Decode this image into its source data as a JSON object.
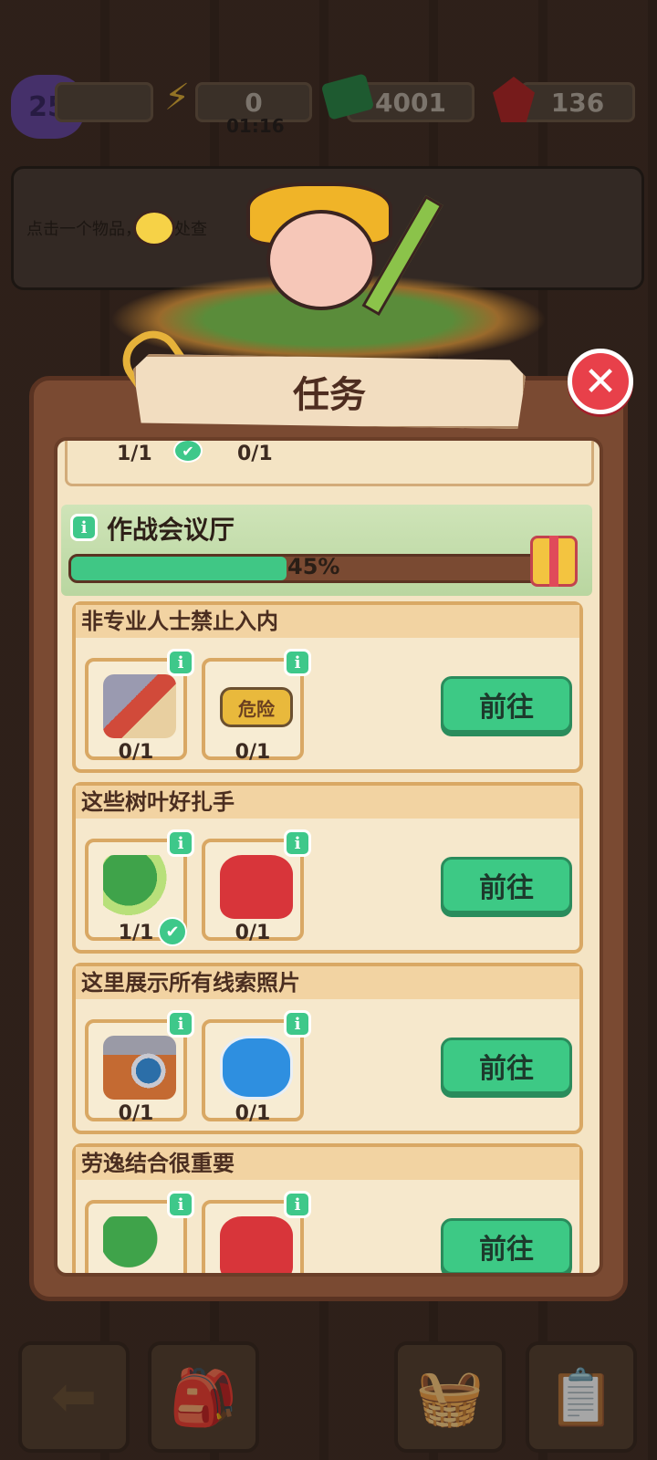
{
  "top": {
    "level": "25",
    "energy": "0",
    "energy_timer": "01:16",
    "cash": "4001",
    "gems": "136"
  },
  "hint": {
    "text": "点击一个物品，在此处查"
  },
  "dialog": {
    "title": "任务",
    "prev_row": {
      "count_a": "1/1",
      "count_b": "0/1"
    },
    "room": {
      "name": "作战会议厅",
      "progress_label": "45%",
      "progress": 0.45
    },
    "tasks": [
      {
        "title": "非专业人士禁止入内",
        "items": [
          {
            "icon": "hammer-icon",
            "count": "0/1",
            "done": false
          },
          {
            "icon": "danger-barrier-icon",
            "count": "0/1",
            "done": false,
            "sign_text": "危险"
          }
        ],
        "button": "前往"
      },
      {
        "title": "这些树叶好扎手",
        "items": [
          {
            "icon": "leaf-broom-icon",
            "count": "1/1",
            "done": true
          },
          {
            "icon": "gloves-icon",
            "count": "0/1",
            "done": false
          }
        ],
        "button": "前往"
      },
      {
        "title": "这里展示所有线索照片",
        "items": [
          {
            "icon": "camera-icon",
            "count": "0/1",
            "done": false
          },
          {
            "icon": "face-mask-icon",
            "count": "0/1",
            "done": false
          }
        ],
        "button": "前往"
      },
      {
        "title": "劳逸结合很重要",
        "items": [
          {
            "icon": "leaf-broom-icon",
            "count": "",
            "done": false
          },
          {
            "icon": "gloves-icon",
            "count": "",
            "done": false
          }
        ],
        "button": "前往"
      }
    ]
  },
  "colors": {
    "accent_green": "#3dc985",
    "panel_brown": "#7a4a32",
    "close_red": "#e8404a"
  }
}
